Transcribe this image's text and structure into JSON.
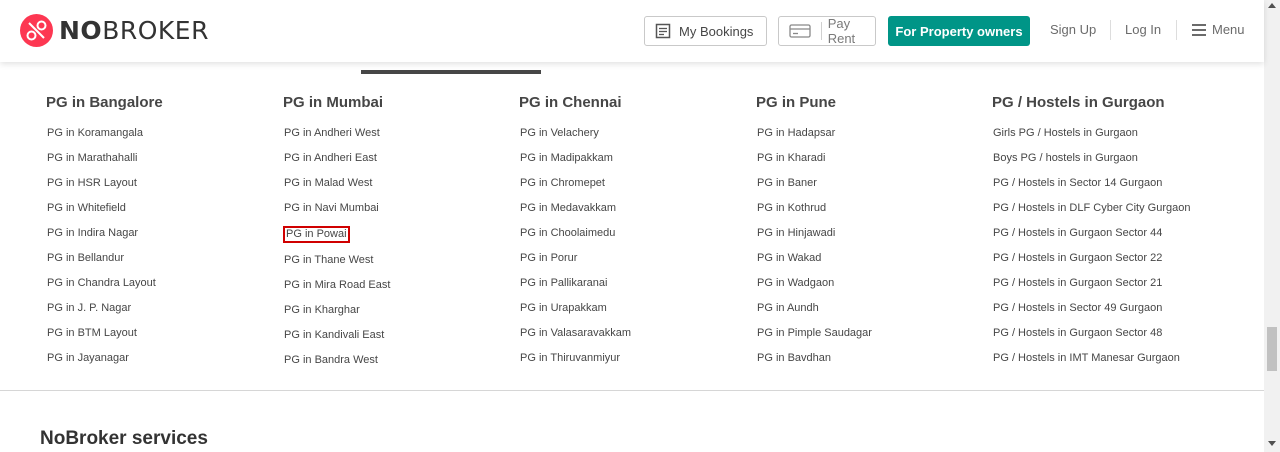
{
  "header": {
    "logo_no": "NO",
    "logo_broker": "BROKER",
    "my_bookings": "My Bookings",
    "pay_rent": "Pay Rent",
    "for_owners": "For Property owners",
    "sign_up": "Sign Up",
    "log_in": "Log In",
    "menu": "Menu"
  },
  "colors": {
    "brand": "#fd3752",
    "owners_button": "#009587",
    "highlight_border": "#d00000"
  },
  "columns": [
    {
      "title": "PG in Bangalore",
      "links": [
        "PG in Koramangala",
        "PG in Marathahalli",
        "PG in HSR Layout",
        "PG in Whitefield",
        "PG in Indira Nagar",
        "PG in Bellandur",
        "PG in Chandra Layout",
        "PG in J. P. Nagar",
        "PG in BTM Layout",
        "PG in Jayanagar"
      ]
    },
    {
      "title": "PG in Mumbai",
      "links": [
        "PG in Andheri West",
        "PG in Andheri East",
        "PG in Malad West",
        "PG in Navi Mumbai",
        "PG in Powai",
        "PG in Thane West",
        "PG in Mira Road East",
        "PG in Kharghar",
        "PG in Kandivali East",
        "PG in Bandra West"
      ]
    },
    {
      "title": "PG in Chennai",
      "links": [
        "PG in Velachery",
        "PG in Madipakkam",
        "PG in Chromepet",
        "PG in Medavakkam",
        "PG in Choolaimedu",
        "PG in Porur",
        "PG in Pallikaranai",
        "PG in Urapakkam",
        "PG in Valasaravakkam",
        "PG in Thiruvanmiyur"
      ]
    },
    {
      "title": "PG in Pune",
      "links": [
        "PG in Hadapsar",
        "PG in Kharadi",
        "PG in Baner",
        "PG in Kothrud",
        "PG in Hinjawadi",
        "PG in Wakad",
        "PG in Wadgaon",
        "PG in Aundh",
        "PG in Pimple Saudagar",
        "PG in Bavdhan"
      ]
    },
    {
      "title": "PG / Hostels in Gurgaon",
      "links": [
        "Girls PG / Hostels in Gurgaon",
        "Boys PG / hostels in Gurgaon",
        "PG / Hostels in Sector 14 Gurgaon",
        "PG / Hostels in DLF Cyber City Gurgaon",
        "PG / Hostels in Gurgaon Sector 44",
        "PG / Hostels in Gurgaon Sector 22",
        "PG / Hostels in Gurgaon Sector 21",
        "PG / Hostels in Sector 49 Gurgaon",
        "PG / Hostels in Gurgaon Sector 48",
        "PG / Hostels in IMT Manesar Gurgaon"
      ]
    }
  ],
  "highlighted_link": "PG in Powai",
  "services": {
    "title": "NoBroker services"
  }
}
